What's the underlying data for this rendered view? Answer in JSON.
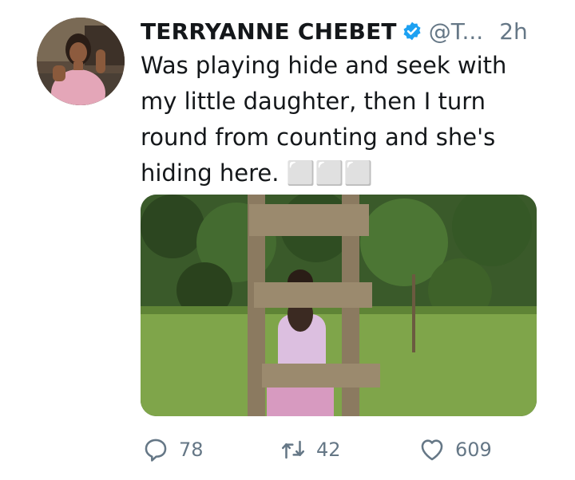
{
  "tweet": {
    "author": {
      "display_name": "TERRYANNE CHEBET",
      "handle": "@T...",
      "verified": true,
      "avatar_icon": "avatar-photo"
    },
    "time": "2h",
    "text": "Was playing hide and seek with my little daughter, then I turn round from counting and she's hiding here. ⬜⬜⬜",
    "media": {
      "type": "photo",
      "icon": "photo-girl-behind-ladder"
    },
    "actions": {
      "replies": "78",
      "retweets": "42",
      "likes": "609"
    }
  },
  "colors": {
    "text": "#14171a",
    "secondary": "#657786",
    "verified": "#1da1f2"
  }
}
